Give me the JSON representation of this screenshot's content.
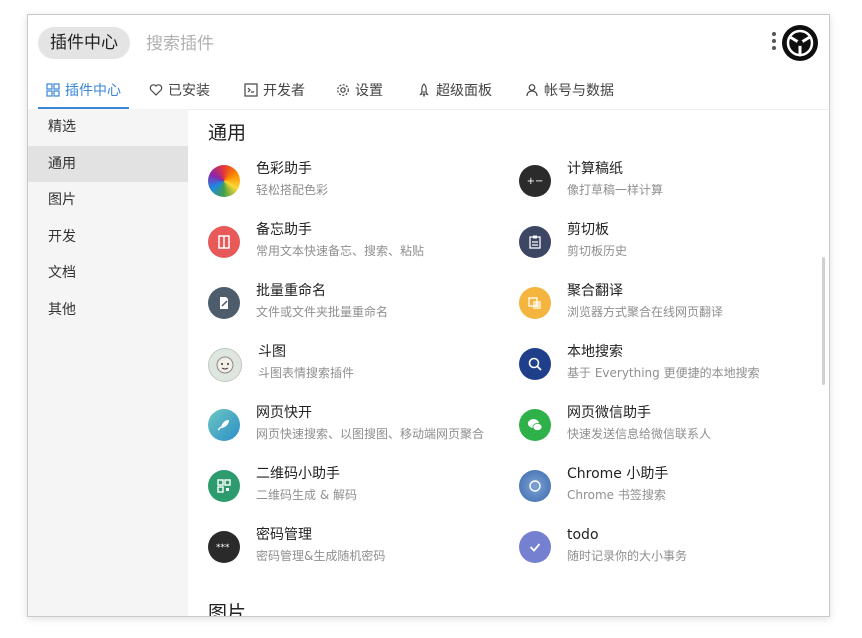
{
  "header": {
    "app_label": "插件中心",
    "search_placeholder": "搜索插件"
  },
  "tabs": [
    {
      "label": "插件中心",
      "icon": "grid-icon",
      "active": true
    },
    {
      "label": "已安装",
      "icon": "heart-icon"
    },
    {
      "label": "开发者",
      "icon": "terminal-icon"
    },
    {
      "label": "设置",
      "icon": "gear-icon"
    },
    {
      "label": "超级面板",
      "icon": "rocket-icon"
    },
    {
      "label": "帐号与数据",
      "icon": "user-icon"
    }
  ],
  "sidebar": {
    "items": [
      {
        "label": "精选"
      },
      {
        "label": "通用",
        "active": true
      },
      {
        "label": "图片"
      },
      {
        "label": "开发"
      },
      {
        "label": "文档"
      },
      {
        "label": "其他"
      }
    ]
  },
  "main": {
    "section_title": "通用",
    "next_section_title": "图片",
    "plugins": [
      {
        "name": "色彩助手",
        "desc": "轻松搭配色彩",
        "icon": "color-wheel-icon",
        "color": "#e04040"
      },
      {
        "name": "计算稿纸",
        "desc": "像打草稿一样计算",
        "icon": "calculator-icon",
        "color": "#2b2b2b"
      },
      {
        "name": "备忘助手",
        "desc": "常用文本快速备忘、搜索、粘贴",
        "icon": "notebook-icon",
        "color": "#e85a5a"
      },
      {
        "name": "剪切板",
        "desc": "剪切板历史",
        "icon": "clipboard-icon",
        "color": "#3d4663"
      },
      {
        "name": "批量重命名",
        "desc": "文件或文件夹批量重命名",
        "icon": "rename-icon",
        "color": "#4e5d6c"
      },
      {
        "name": "聚合翻译",
        "desc": "浏览器方式聚合在线网页翻译",
        "icon": "translate-icon",
        "color": "#f3b53d"
      },
      {
        "name": "斗图",
        "desc": "斗图表情搜索插件",
        "icon": "meme-face-icon",
        "color": "#cfd8cf"
      },
      {
        "name": "本地搜索",
        "desc": "基于 Everything 更便捷的本地搜索",
        "icon": "search-icon",
        "color": "#1f3f8a"
      },
      {
        "name": "网页快开",
        "desc": "网页快速搜索、以图搜图、移动端网页聚合",
        "icon": "rocket-icon",
        "color": "#3aa0a8"
      },
      {
        "name": "网页微信助手",
        "desc": "快速发送信息给微信联系人",
        "icon": "wechat-icon",
        "color": "#2fb14a"
      },
      {
        "name": "二维码小助手",
        "desc": "二维码生成 & 解码",
        "icon": "qrcode-icon",
        "color": "#2e9b6f"
      },
      {
        "name": "Chrome 小助手",
        "desc": "Chrome 书签搜索",
        "icon": "chrome-icon",
        "color": "#4d7ab8"
      },
      {
        "name": "密码管理",
        "desc": "密码管理&生成随机密码",
        "icon": "password-icon",
        "color": "#2a2a2a"
      },
      {
        "name": "todo",
        "desc": "随时记录你的大小事务",
        "icon": "check-icon",
        "color": "#7581d0"
      }
    ]
  },
  "colors": {
    "accent": "#3a86d6",
    "sidebar_bg": "#f5f5f5",
    "sidebar_active": "#e2e2e2"
  }
}
